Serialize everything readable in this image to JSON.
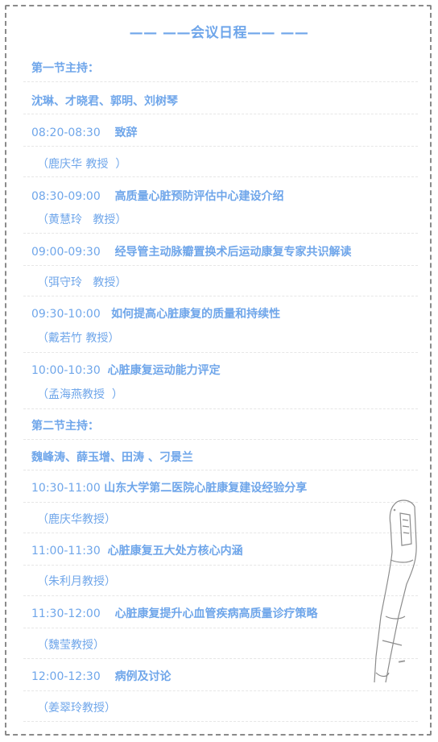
{
  "title": "—— ——会议日程—— ——",
  "session1": {
    "host_label": "第一节主持：",
    "hosts": "沈琳、才晓君、郭明、刘树琴"
  },
  "session1_items": [
    {
      "time": "08:20-08:30",
      "gap": "    ",
      "topic": "致辞",
      "speaker": "（鹿庆华 教授  ）"
    },
    {
      "time": "08:30-09:00",
      "gap": "    ",
      "topic": "高质量心脏预防评估中心建设介绍",
      "speaker": "（黄慧玲   教授）"
    },
    {
      "time": "09:00-09:30",
      "gap": "    ",
      "topic": "经导管主动脉瓣置换术后运动康复专家共识解读",
      "speaker": "（弭守玲   教授）"
    },
    {
      "time": "09:30-10:00",
      "gap": "   ",
      "topic": "如何提高心脏康复的质量和持续性",
      "speaker": "（戴若竹 教授）"
    },
    {
      "time": "10:00-10:30",
      "gap": "  ",
      "topic": "心脏康复运动能力评定",
      "speaker": "（孟海燕教授  ）"
    }
  ],
  "session2": {
    "host_label": "第二节主持：",
    "hosts": "魏峰涛、薛玉增、田涛 、刁景兰"
  },
  "session2_items": [
    {
      "time": "10:30-11:00",
      "gap": " ",
      "topic": "山东大学第二医院心脏康复建设经验分享",
      "speaker": "（鹿庆华教授）"
    },
    {
      "time": "11:00-11:30",
      "gap": "  ",
      "topic": "心脏康复五大处方核心内涵",
      "speaker": "（朱利月教授）"
    },
    {
      "time": "11:30-12:00",
      "gap": "    ",
      "topic": "心脏康复提升心血管疾病高质量诊疗策略",
      "speaker": "（魏莹教授）"
    },
    {
      "time": "12:00-12:30",
      "gap": "    ",
      "topic": "病例及讨论",
      "speaker": "（姜翠玲教授）"
    }
  ],
  "colors": {
    "accent": "#6fa6ea",
    "border": "#8a8a8a",
    "divider": "#e6e6e6"
  },
  "decoration": {
    "icon": "ecg-pen-icon"
  }
}
